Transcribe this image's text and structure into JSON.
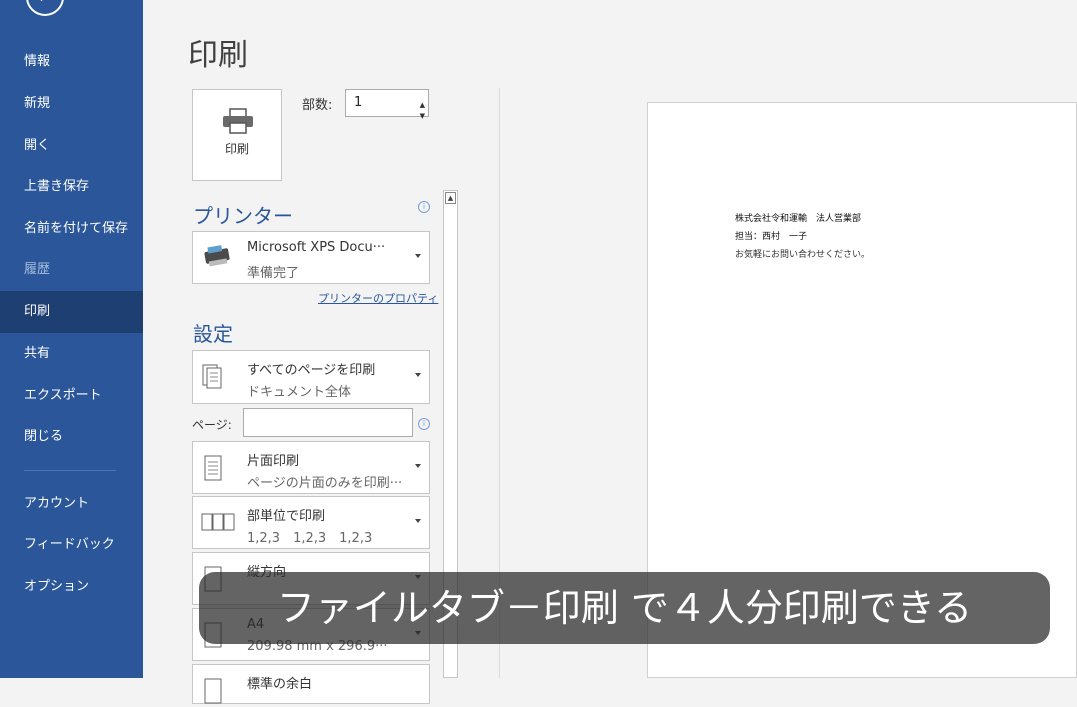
{
  "sidebar": {
    "back_icon": "back-arrow-icon",
    "items": [
      {
        "label": "情報"
      },
      {
        "label": "新規"
      },
      {
        "label": "開く"
      },
      {
        "label": "上書き保存"
      },
      {
        "label": "名前を付けて保存"
      },
      {
        "label": "履歴"
      },
      {
        "label": "印刷"
      },
      {
        "label": "共有"
      },
      {
        "label": "エクスポート"
      },
      {
        "label": "閉じる"
      },
      {
        "label": "アカウント"
      },
      {
        "label": "フィードバック"
      },
      {
        "label": "オプション"
      }
    ],
    "active_item": "印刷",
    "accent_color": "#2b579a"
  },
  "main": {
    "title": "印刷",
    "print_button_label": "印刷",
    "copies_label": "部数:",
    "copies_value": "1",
    "printer_section_title": "プリンター",
    "printer_name": "Microsoft XPS Docu···",
    "printer_status": "準備完了",
    "printer_properties_link": "プリンターのプロパティ",
    "settings_title": "設定",
    "settings": [
      {
        "main": "すべてのページを印刷",
        "sub": "ドキュメント全体",
        "icon": "pages-icon"
      },
      {
        "main": "片面印刷",
        "sub": "ページの片面のみを印刷···",
        "icon": "single-side-icon"
      },
      {
        "main": "部単位で印刷",
        "sub": "1,2,3　1,2,3　1,2,3",
        "icon": "collate-icon"
      },
      {
        "main": "縦方向",
        "sub": "",
        "icon": "portrait-icon"
      },
      {
        "main": "A4",
        "sub": "209.98 mm x 296.9···",
        "icon": "paper-size-icon"
      },
      {
        "main": "標準の余白",
        "sub": "",
        "icon": "margins-icon"
      }
    ],
    "pages_label": "ページ:",
    "pages_value": ""
  },
  "preview": {
    "lines": [
      "株式会社令和運輸　法人営業部",
      "担当：西村　一子",
      "お気軽にお問い合わせください。"
    ]
  },
  "caption": "ファイルタブ－印刷 で４人分印刷できる"
}
